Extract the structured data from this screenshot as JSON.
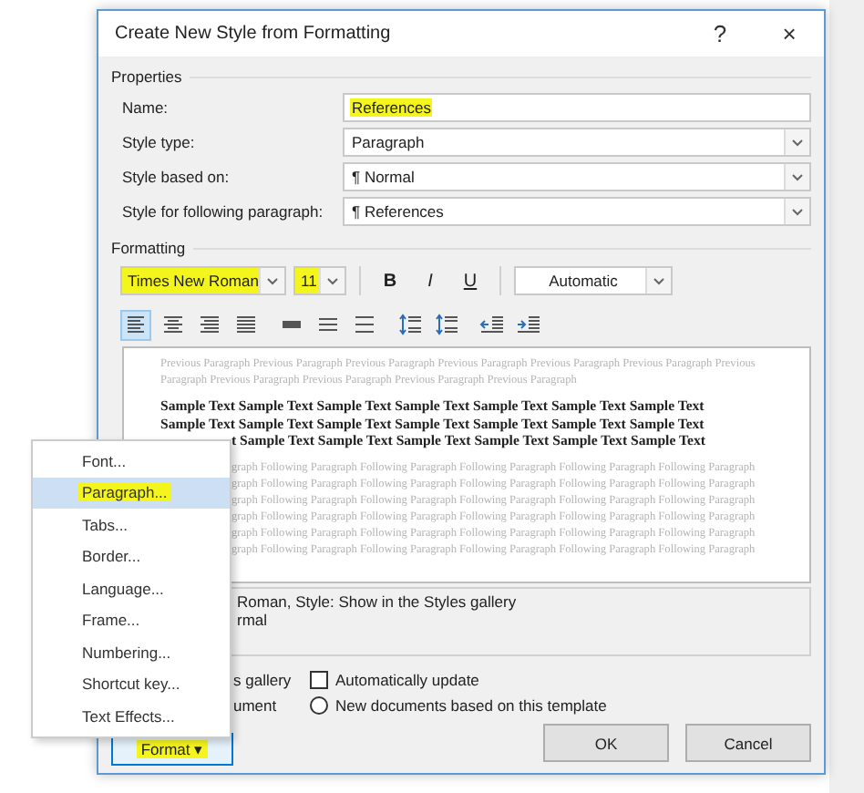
{
  "window": {
    "title": "Create New Style from Formatting",
    "help": "?",
    "close": "×"
  },
  "properties": {
    "heading": "Properties",
    "rows": [
      {
        "label": "Name:",
        "kind": "input",
        "value": "References",
        "highlighted": true
      },
      {
        "label": "Style type:",
        "kind": "select",
        "value": "Paragraph",
        "highlighted": false
      },
      {
        "label": "Style based on:",
        "kind": "select",
        "prefix": "¶",
        "value": "Normal",
        "highlighted": false
      },
      {
        "label": "Style for following paragraph:",
        "kind": "select",
        "prefix": "¶",
        "value": "References",
        "highlighted": false
      }
    ]
  },
  "formatting": {
    "heading": "Formatting",
    "font": {
      "value": "Times New Roman",
      "highlighted": true
    },
    "size": {
      "value": "11",
      "highlighted": true
    },
    "styles": [
      {
        "label": "B",
        "kind": "bold"
      },
      {
        "label": "I",
        "kind": "italic"
      },
      {
        "label": "U",
        "kind": "underline"
      }
    ],
    "color": {
      "value": "Automatic"
    },
    "paragraph_tools": [
      {
        "kind": "align-left",
        "selected": true
      },
      {
        "kind": "align-center",
        "selected": false
      },
      {
        "kind": "align-right",
        "selected": false
      },
      {
        "kind": "justify",
        "selected": false
      },
      {
        "kind": "single-spacing",
        "selected": false
      },
      {
        "kind": "one-half-spacing",
        "selected": false
      },
      {
        "kind": "double-spacing",
        "selected": false
      },
      {
        "kind": "space-before",
        "selected": false
      },
      {
        "kind": "space-after",
        "selected": false
      },
      {
        "kind": "decrease-indent",
        "selected": false
      },
      {
        "kind": "increase-indent",
        "selected": false
      }
    ]
  },
  "preview": {
    "clear_lines": [
      {
        "kind": "previous",
        "text": "Previous Paragraph Previous Paragraph Previous Paragraph Previous Paragraph Previous Paragraph Previous Paragraph Previous"
      },
      {
        "kind": "previous",
        "text": "Paragraph Previous Paragraph Previous Paragraph Previous Paragraph Previous Paragraph"
      },
      {
        "kind": "sample",
        "text": "Sample Text Sample Text Sample Text Sample Text Sample Text Sample Text Sample Text"
      },
      {
        "kind": "sample",
        "text": "Sample Text Sample Text Sample Text Sample Text Sample Text Sample Text Sample Text"
      }
    ],
    "covered_lines": [
      {
        "kind": "sample",
        "text": "t Sample Text Sample Text Sample Text Sample Text Sample Text Sample Text"
      },
      {
        "kind": "following",
        "text": "graph Following Paragraph Following Paragraph Following Paragraph Following Paragraph Following Paragraph"
      },
      {
        "kind": "following",
        "text": "graph Following Paragraph Following Paragraph Following Paragraph Following Paragraph Following Paragraph"
      },
      {
        "kind": "following",
        "text": "graph Following Paragraph Following Paragraph Following Paragraph Following Paragraph Following Paragraph"
      },
      {
        "kind": "following",
        "text": "graph Following Paragraph Following Paragraph Following Paragraph Following Paragraph Following Paragraph"
      },
      {
        "kind": "following",
        "text": "graph Following Paragraph Following Paragraph Following Paragraph Following Paragraph Following Paragraph"
      },
      {
        "kind": "following",
        "text": "graph Following Paragraph Following Paragraph Following Paragraph Following Paragraph Following Paragraph"
      }
    ]
  },
  "description": [
    "Roman, Style: Show in the Styles gallery",
    "rmal"
  ],
  "options": [
    {
      "kind": "fragment",
      "label": "s gallery"
    },
    {
      "kind": "checkbox",
      "label": "Automatically update",
      "checked": false
    },
    {
      "kind": "fragment",
      "label": "ument"
    },
    {
      "kind": "radio",
      "label": "New documents based on this template",
      "selected": false
    }
  ],
  "buttons": [
    {
      "kind": "menu",
      "label": "Format",
      "caret": "▾",
      "highlighted": true
    },
    {
      "kind": "ok",
      "label": "OK"
    },
    {
      "kind": "cancel",
      "label": "Cancel"
    }
  ],
  "format_menu": [
    {
      "label": "Font...",
      "selected": false,
      "highlighted": false
    },
    {
      "label": "Paragraph...",
      "selected": true,
      "highlighted": true
    },
    {
      "label": "Tabs...",
      "selected": false,
      "highlighted": false
    },
    {
      "label": "Border...",
      "selected": false,
      "highlighted": false
    },
    {
      "label": "Language...",
      "selected": false,
      "highlighted": false
    },
    {
      "label": "Frame...",
      "selected": false,
      "highlighted": false
    },
    {
      "label": "Numbering...",
      "selected": false,
      "highlighted": false
    },
    {
      "label": "Shortcut key...",
      "selected": false,
      "highlighted": false
    },
    {
      "label": "Text Effects...",
      "selected": false,
      "highlighted": false
    }
  ]
}
